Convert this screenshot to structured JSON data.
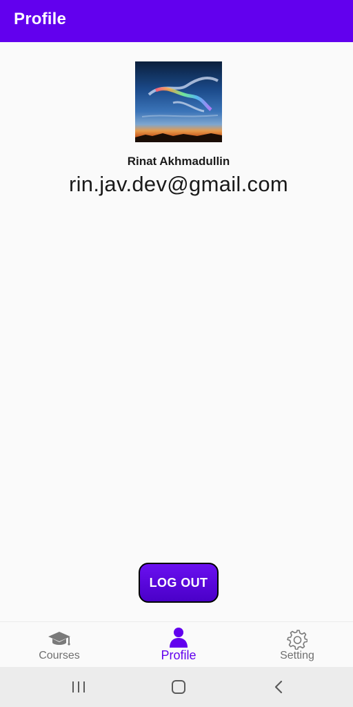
{
  "app_bar": {
    "title": "Profile"
  },
  "profile": {
    "avatar_icon": "sky-photo",
    "name": "Rinat Akhmadullin",
    "email": "rin.jav.dev@gmail.com"
  },
  "actions": {
    "logout_label": "LOG OUT"
  },
  "bottom_nav": {
    "items": [
      {
        "label": "Courses",
        "icon": "graduation-cap-icon",
        "active": false
      },
      {
        "label": "Profile",
        "icon": "person-icon",
        "active": true
      },
      {
        "label": "Setting",
        "icon": "gear-icon",
        "active": false
      }
    ]
  },
  "system_nav": {
    "items": [
      "recent-apps-icon",
      "home-icon",
      "back-icon"
    ]
  },
  "colors": {
    "primary": "#6200ee",
    "inactive": "#6f6f6f",
    "background": "#fafafa"
  }
}
